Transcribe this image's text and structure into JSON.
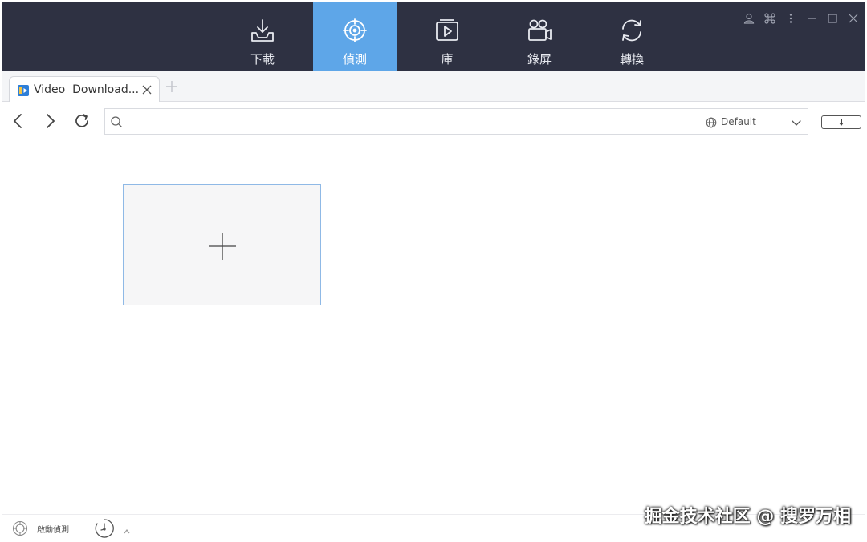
{
  "nav": {
    "items": [
      {
        "label": "下載",
        "icon": "download-icon"
      },
      {
        "label": "偵測",
        "icon": "detect-target-icon",
        "active": true
      },
      {
        "label": "庫",
        "icon": "library-video-icon"
      },
      {
        "label": "錄屏",
        "icon": "screen-record-camera-icon"
      },
      {
        "label": "轉換",
        "icon": "convert-refresh-icon"
      }
    ],
    "active_color": "#5ea6e8",
    "bar_color": "#2e3142"
  },
  "window_controls": [
    "user-icon",
    "shortcut-icon",
    "more-menu-icon",
    "minimize-icon",
    "maximize-icon",
    "close-icon"
  ],
  "tabs": [
    {
      "title": "Video  Download...",
      "favicon": "video-downloader-favicon"
    }
  ],
  "address": {
    "value": "",
    "placeholder": "",
    "profile_label": "Default"
  },
  "status": {
    "detect_label": "啟動偵測"
  },
  "watermark": "掘金技术社区 @ 搜罗万相"
}
